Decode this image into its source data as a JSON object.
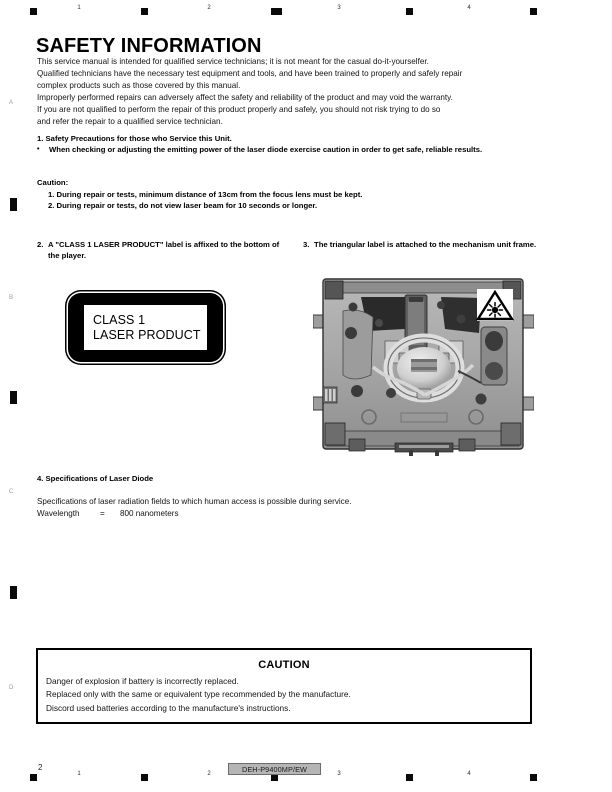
{
  "document": {
    "title": "SAFETY INFORMATION",
    "page_number": "2",
    "model": "DEH-P9400MP/EW"
  },
  "registration": {
    "top_numbers": [
      "1",
      "2",
      "3",
      "4"
    ],
    "bottom_numbers": [
      "1",
      "2",
      "3",
      "4"
    ],
    "margin_letters": [
      "A",
      "B",
      "C",
      "D"
    ]
  },
  "intro": {
    "lines": [
      "This service manual is intended for qualified service technicians; it is not meant for the casual do-it-yourselfer.",
      "Qualified technicians have the necessary test equipment and tools, and have been trained to properly and safely repair",
      "complex products such as those covered by this manual.",
      "Improperly performed repairs can adversely affect the safety and reliability of the product and may void the warranty.",
      "If you are not qualified to perform the repair of this product properly and safely, you should not risk trying to do so",
      "and refer the repair to a qualified service technician."
    ]
  },
  "section1": {
    "heading": "1. Safety Precautions for those who Service this Unit.",
    "bullet_marker": "•",
    "bullet_text": "When checking or adjusting the emitting power of the laser diode exercise caution in order to get safe, reliable results.",
    "caution_label": "Caution:",
    "caution_items": [
      "1. During repair or tests, minimum distance of 13cm from the focus lens must be kept.",
      "2. During repair or tests, do not view laser beam for 10 seconds or longer."
    ]
  },
  "section2": {
    "number": "2.",
    "text": "A \"CLASS 1 LASER PRODUCT\" label is affixed to the bottom of the player.",
    "label": {
      "line1": "CLASS 1",
      "line2": "LASER PRODUCT"
    }
  },
  "section3": {
    "number": "3.",
    "text": "The triangular label is attached to the mechanism unit frame.",
    "photo_caption": "cd-mechanism-unit-photo",
    "warning_symbol": "laser-radiation-triangle"
  },
  "section4": {
    "heading": "4. Specifications of Laser Diode",
    "description": "Specifications of laser radiation fields to which human access is possible during service.",
    "wavelength_label": "Wavelength",
    "wavelength_equals": "=",
    "wavelength_value": "800 nanometers"
  },
  "caution_box": {
    "title": "CAUTION",
    "lines": [
      "Danger of explosion if battery is incorrectly replaced.",
      "Replaced only with the same or equivalent type recommended by the manufacture.",
      "Discord used batteries according to the manufacture's instructions."
    ]
  },
  "colors": {
    "ink": "#000000",
    "footer_box": "#b5b5b5",
    "margin_letter": "#9a9a9a"
  }
}
